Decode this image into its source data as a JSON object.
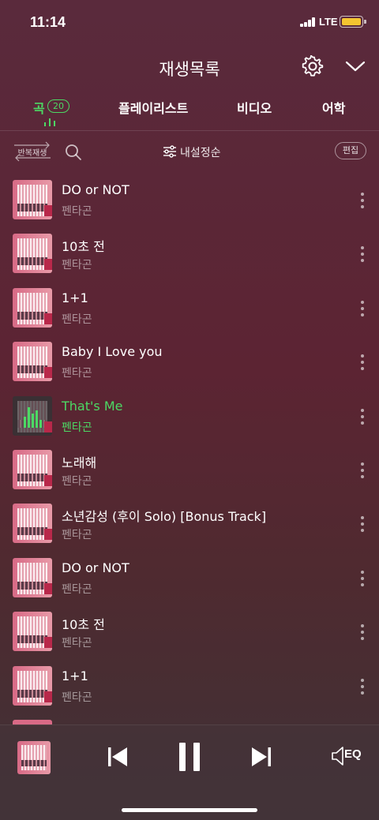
{
  "status": {
    "time": "11:14",
    "network": "LTE"
  },
  "header": {
    "title": "재생목록"
  },
  "tabs": [
    {
      "label": "곡",
      "count": "20",
      "active": true
    },
    {
      "label": "플레이리스트"
    },
    {
      "label": "비디오"
    },
    {
      "label": "어학"
    }
  ],
  "toolbar": {
    "repeat_label": "반복재생",
    "sort_label": "내설정순",
    "edit_label": "편집"
  },
  "songs": [
    {
      "title": "DO or NOT",
      "artist": "펜타곤"
    },
    {
      "title": "10초 전",
      "artist": "펜타곤"
    },
    {
      "title": "1+1",
      "artist": "펜타곤"
    },
    {
      "title": "Baby I Love you",
      "artist": "펜타곤"
    },
    {
      "title": "That's Me",
      "artist": "펜타곤",
      "playing": true
    },
    {
      "title": "노래해",
      "artist": "펜타곤"
    },
    {
      "title": "소년감성 (후이 Solo) [Bonus Track]",
      "artist": "펜타곤"
    },
    {
      "title": "DO or NOT",
      "artist": "펜타곤"
    },
    {
      "title": "10초 전",
      "artist": "펜타곤"
    },
    {
      "title": "1+1",
      "artist": "펜타곤"
    }
  ],
  "player": {
    "eq_label": "EQ"
  },
  "colors": {
    "accent": "#4cd964",
    "battery": "#f4c430"
  }
}
